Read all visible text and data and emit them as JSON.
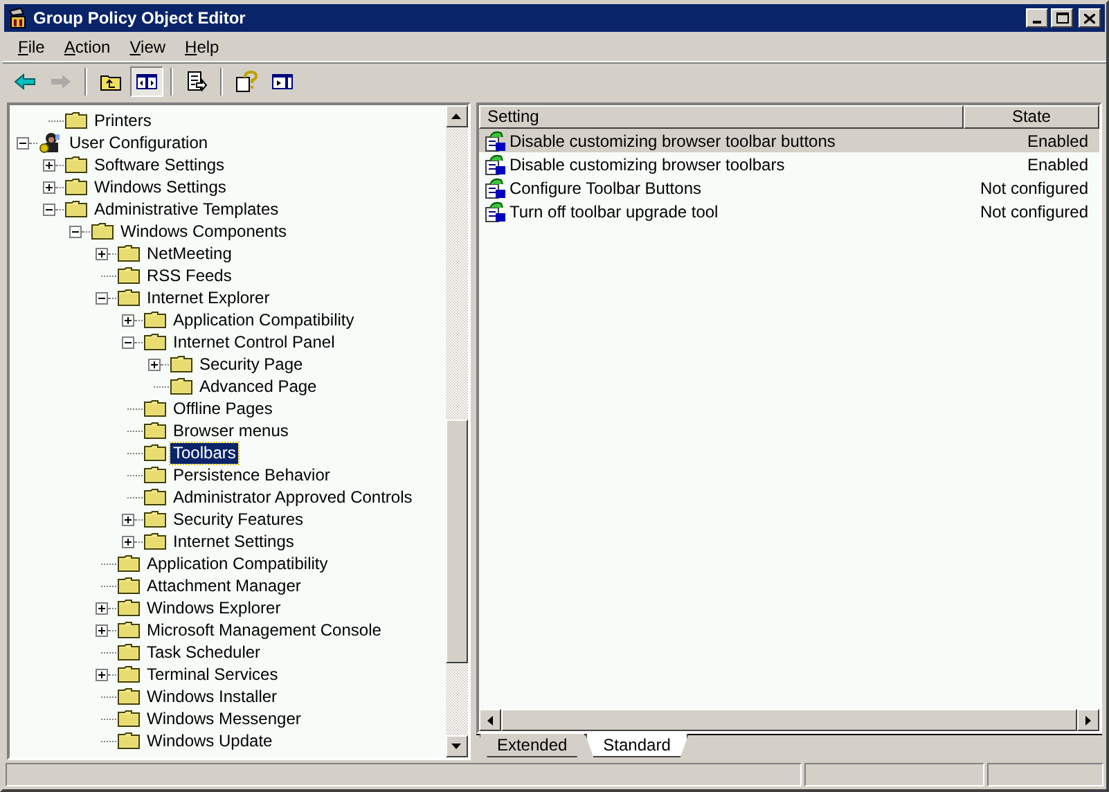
{
  "window": {
    "title": "Group Policy Object Editor"
  },
  "menu": [
    "File",
    "Action",
    "View",
    "Help"
  ],
  "toolbar": [
    {
      "kind": "back",
      "disabled": false,
      "pressed": false
    },
    {
      "kind": "forward",
      "disabled": true,
      "pressed": false
    },
    {
      "kind": "separator"
    },
    {
      "kind": "up",
      "disabled": false,
      "pressed": false
    },
    {
      "kind": "tree",
      "disabled": false,
      "pressed": true
    },
    {
      "kind": "separator"
    },
    {
      "kind": "export",
      "disabled": false,
      "pressed": false
    },
    {
      "kind": "separator"
    },
    {
      "kind": "help",
      "disabled": false,
      "pressed": false
    },
    {
      "kind": "actionpane",
      "disabled": false,
      "pressed": false
    }
  ],
  "tree": [
    {
      "children": [
        {
          "label": "Printers",
          "selected": false
        }
      ]
    },
    {
      "label": "User Configuration",
      "kind": "user",
      "expanded": true,
      "selected": false,
      "children": [
        {
          "label": "Software Settings",
          "expanded": false,
          "selected": false
        },
        {
          "label": "Windows Settings",
          "expanded": false,
          "selected": false
        },
        {
          "label": "Administrative Templates",
          "expanded": true,
          "selected": false,
          "children": [
            {
              "label": "Windows Components",
              "expanded": true,
              "selected": false,
              "children": [
                {
                  "label": "NetMeeting",
                  "expanded": false,
                  "selected": false
                },
                {
                  "label": "RSS Feeds",
                  "selected": false
                },
                {
                  "label": "Internet Explorer",
                  "expanded": true,
                  "selected": false,
                  "children": [
                    {
                      "label": "Application Compatibility",
                      "expanded": false,
                      "selected": false
                    },
                    {
                      "label": "Internet Control Panel",
                      "expanded": true,
                      "selected": false,
                      "children": [
                        {
                          "label": "Security Page",
                          "expanded": false,
                          "selected": false
                        },
                        {
                          "label": "Advanced Page",
                          "selected": false
                        }
                      ]
                    },
                    {
                      "label": "Offline Pages",
                      "selected": false
                    },
                    {
                      "label": "Browser menus",
                      "selected": false
                    },
                    {
                      "label": "Toolbars",
                      "selected": true
                    },
                    {
                      "label": "Persistence Behavior",
                      "selected": false
                    },
                    {
                      "label": "Administrator Approved Controls",
                      "selected": false
                    },
                    {
                      "label": "Security Features",
                      "expanded": false,
                      "selected": false
                    },
                    {
                      "label": "Internet Settings",
                      "expanded": false,
                      "selected": false
                    }
                  ]
                },
                {
                  "label": "Application Compatibility",
                  "selected": false
                },
                {
                  "label": "Attachment Manager",
                  "selected": false
                },
                {
                  "label": "Windows Explorer",
                  "expanded": false,
                  "selected": false
                },
                {
                  "label": "Microsoft Management Console",
                  "expanded": false,
                  "selected": false
                },
                {
                  "label": "Task Scheduler",
                  "selected": false
                },
                {
                  "label": "Terminal Services",
                  "expanded": false,
                  "selected": false
                },
                {
                  "label": "Windows Installer",
                  "selected": false
                },
                {
                  "label": "Windows Messenger",
                  "selected": false
                },
                {
                  "label": "Windows Update",
                  "selected": false
                }
              ]
            }
          ]
        }
      ]
    }
  ],
  "settings": {
    "columns": [
      "Setting",
      "State"
    ],
    "rows": [
      {
        "setting": "Disable customizing browser toolbar buttons",
        "state": "Enabled",
        "selected": true
      },
      {
        "setting": "Disable customizing browser toolbars",
        "state": "Enabled",
        "selected": false
      },
      {
        "setting": "Configure Toolbar Buttons",
        "state": "Not configured",
        "selected": false
      },
      {
        "setting": "Turn off toolbar upgrade tool",
        "state": "Not configured",
        "selected": false
      }
    ]
  },
  "tabs": [
    {
      "label": "Extended",
      "selected": false
    },
    {
      "label": "Standard",
      "selected": true
    }
  ]
}
